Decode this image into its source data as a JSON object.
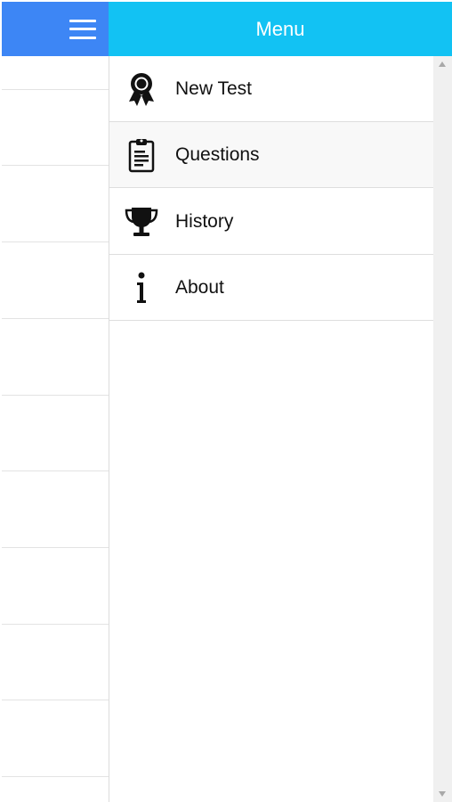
{
  "header": {
    "title": "Menu"
  },
  "menu": {
    "items": [
      {
        "label": "New Test",
        "icon": "award-ribbon-icon"
      },
      {
        "label": "Questions",
        "icon": "clipboard-icon"
      },
      {
        "label": "History",
        "icon": "trophy-icon"
      },
      {
        "label": "About",
        "icon": "info-icon"
      }
    ]
  },
  "colors": {
    "left_header": "#3d86f5",
    "menu_header": "#12c2f3"
  }
}
